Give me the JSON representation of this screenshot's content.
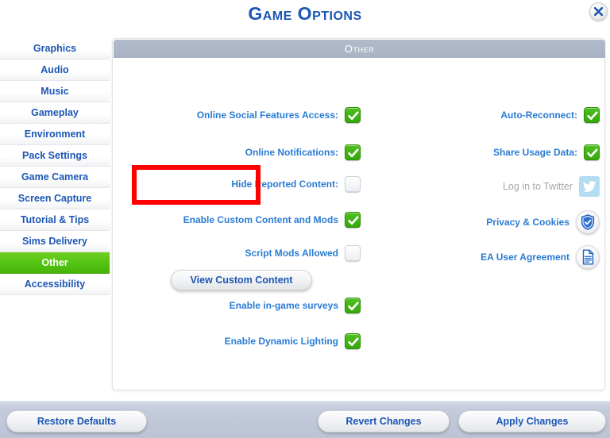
{
  "window": {
    "title": "Game Options",
    "close_icon": "close-x-icon"
  },
  "sidebar": {
    "items": [
      {
        "label": "Graphics",
        "selected": false
      },
      {
        "label": "Audio",
        "selected": false
      },
      {
        "label": "Music",
        "selected": false
      },
      {
        "label": "Gameplay",
        "selected": false
      },
      {
        "label": "Environment",
        "selected": false
      },
      {
        "label": "Pack Settings",
        "selected": false
      },
      {
        "label": "Game Camera",
        "selected": false
      },
      {
        "label": "Screen Capture",
        "selected": false
      },
      {
        "label": "Tutorial & Tips",
        "selected": false
      },
      {
        "label": "Sims Delivery",
        "selected": false
      },
      {
        "label": "Other",
        "selected": true
      },
      {
        "label": "Accessibility",
        "selected": false
      }
    ]
  },
  "panel": {
    "header": "Other",
    "left_column": [
      {
        "label": "Online Social Features Access:",
        "control": "checkbox",
        "checked": true,
        "disabled": false
      },
      {
        "label": "Online Notifications:",
        "control": "checkbox",
        "checked": true,
        "disabled": false
      },
      {
        "label": "Hide Reported Content:",
        "control": "checkbox",
        "checked": false,
        "disabled": false
      },
      {
        "label": "Enable Custom Content and Mods",
        "control": "checkbox",
        "checked": true,
        "disabled": false
      },
      {
        "label": "Script Mods Allowed",
        "control": "checkbox",
        "checked": false,
        "disabled": false
      },
      {
        "label": "View Custom Content",
        "control": "button",
        "checked": null,
        "disabled": false
      },
      {
        "label": "Enable in-game surveys",
        "control": "checkbox",
        "checked": true,
        "disabled": false
      },
      {
        "label": "Enable Dynamic Lighting",
        "control": "checkbox",
        "checked": true,
        "disabled": false
      }
    ],
    "right_column": [
      {
        "label": "Auto-Reconnect:",
        "control": "checkbox",
        "checked": true,
        "disabled": false,
        "icon": ""
      },
      {
        "label": "Share Usage Data:",
        "control": "checkbox",
        "checked": true,
        "disabled": false,
        "icon": ""
      },
      {
        "label": "Log in to Twitter",
        "control": "icon-square",
        "checked": null,
        "disabled": true,
        "icon": "twitter-bird-icon"
      },
      {
        "label": "Privacy & Cookies",
        "control": "icon-round",
        "checked": null,
        "disabled": false,
        "icon": "shield-check-icon"
      },
      {
        "label": "EA User Agreement",
        "control": "icon-round",
        "checked": null,
        "disabled": false,
        "icon": "document-icon"
      }
    ]
  },
  "annotation": {
    "target": "Enable Custom Content and Mods",
    "color": "#ff0000"
  },
  "footer": {
    "restore_label": "Restore Defaults",
    "revert_label": "Revert Changes",
    "apply_label": "Apply Changes"
  },
  "colors": {
    "title_blue": "#1c56b5",
    "label_blue": "#2a7bd4",
    "selected_green": "#54c213",
    "header_grey": "#a8b2c3",
    "footer_blue_grey": "#c4cbdb",
    "annotation_red": "#ff0000",
    "disabled_grey": "#a8a8a8"
  }
}
